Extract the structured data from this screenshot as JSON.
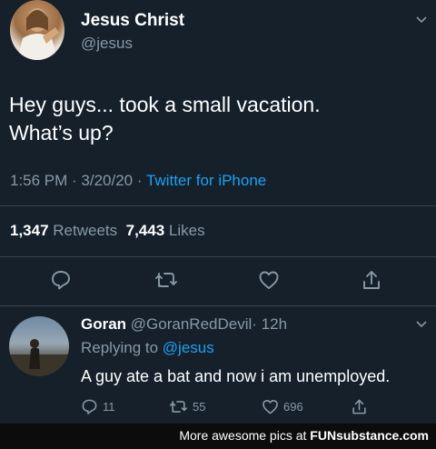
{
  "tweet": {
    "name": "Jesus Christ",
    "handle": "@jesus",
    "text_line1": "Hey guys... took a small vacation.",
    "text_line2": "What’s up?",
    "time": "1:56 PM",
    "sep1": " · ",
    "date": "3/20/20",
    "sep2": " · ",
    "source": "Twitter for iPhone",
    "retweets_count": "1,347",
    "retweets_label": "Retweets",
    "likes_count": "7,443",
    "likes_label": "Likes"
  },
  "reply": {
    "name": "Goran",
    "handle": "@GoranRedDevil",
    "time": "· 12h",
    "replying_to_label": "Replying to ",
    "replying_to_handle": "@jesus",
    "text": "A guy ate a bat and now i am unemployed.",
    "reply_count": "11",
    "retweet_count": "55",
    "like_count": "696"
  },
  "footer": {
    "prefix": "More awesome pics at ",
    "brand": "FUNsubstance.com"
  },
  "colors": {
    "background": "#15202b",
    "text": "#ffffff",
    "secondary": "#8899a6",
    "accent": "#1da1f2",
    "divider": "#38444d"
  },
  "icons": [
    "chevron-down-icon",
    "reply-icon",
    "retweet-icon",
    "like-icon",
    "share-icon"
  ]
}
